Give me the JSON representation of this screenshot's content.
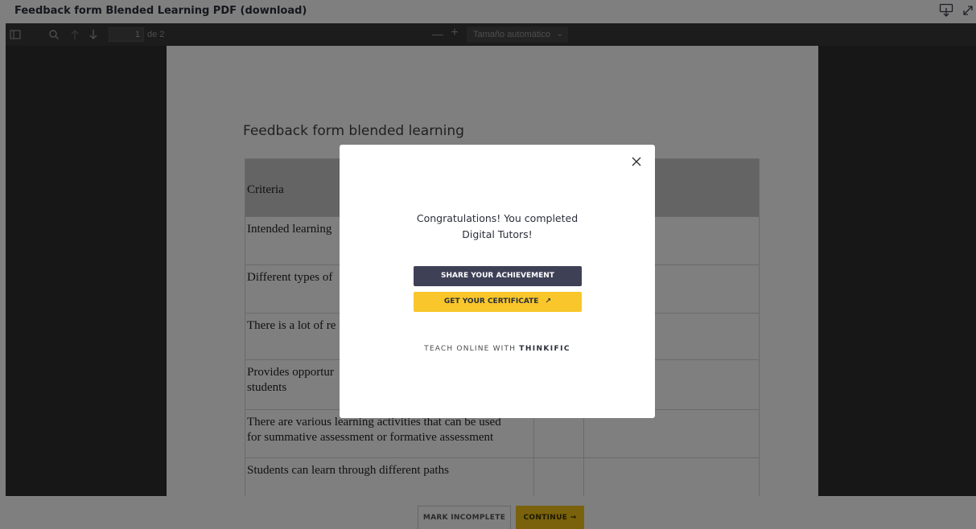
{
  "header": {
    "title": "Feedback form Blended Learning PDF (download)",
    "icons": [
      "download-tray-icon",
      "expand-icon"
    ]
  },
  "pdf_toolbar": {
    "icons": [
      "sidebar-toggle-icon",
      "search-icon",
      "arrow-up-icon",
      "arrow-down-icon",
      "zoom-out-icon",
      "zoom-in-icon"
    ],
    "page_number": "1",
    "page_of": "de 2",
    "zoom_minus": "—",
    "zoom_plus": "+",
    "zoom_value": "Tamaño automático"
  },
  "pdf": {
    "heading": "Feedback form blended learning",
    "rows": [
      "Criteria",
      "Intended learning",
      "Different types of",
      "There is a lot of re",
      "Provides opportur",
      "students",
      "There are various learning activities that can be used",
      "for summative assessment or formative assessment",
      "Students can learn through different paths"
    ]
  },
  "modal": {
    "message_line1": "Congratulations! You completed",
    "message_line2": "Digital Tutors!",
    "share_label": "SHARE YOUR ACHIEVEMENT",
    "certificate_label": "GET YOUR CERTIFICATE",
    "certificate_arrow": "↗",
    "teach_text": "TEACH ONLINE WITH",
    "teach_brand": "THINKIFIC"
  },
  "footer": {
    "mark_incomplete_label": "MARK INCOMPLETE",
    "continue_label": "CONTINUE →"
  },
  "colors": {
    "share_button": "#3e4056",
    "certificate_button": "#f9c72b",
    "continue_button": "#f5c518"
  }
}
